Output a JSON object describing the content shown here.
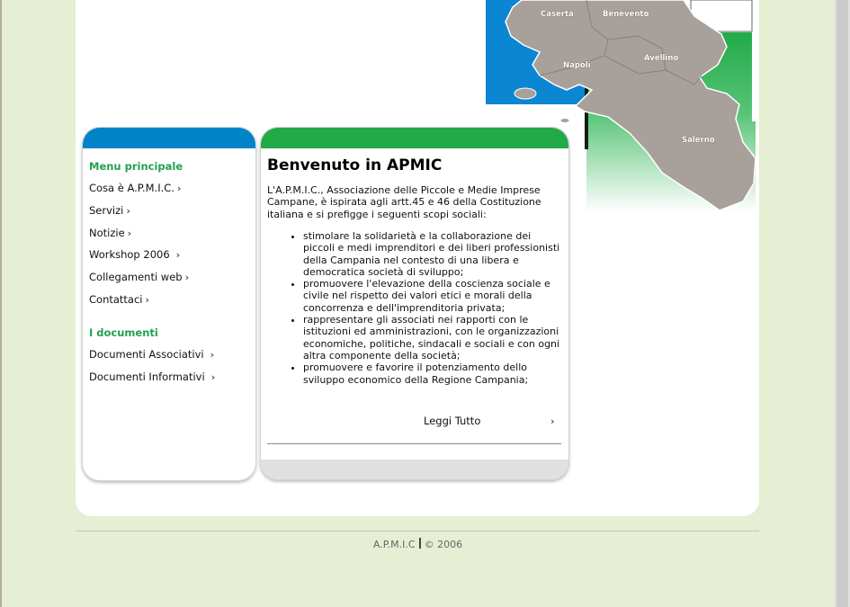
{
  "colors": {
    "page_background": "#e6eed3",
    "sidebar_cap": "#0083c8",
    "content_cap": "#22aa48",
    "section_title": "#21a14d",
    "map_region": "#a8a09a",
    "map_sea": "#0a86d2",
    "map_green": "#22aa48"
  },
  "map": {
    "labels": [
      "Caserta",
      "Benevento",
      "Napoli",
      "Avellino",
      "Salerno"
    ]
  },
  "sidebar": {
    "main_menu_title": "Menu principale",
    "main_menu": [
      {
        "label": "Cosa è A.P.M.I.C."
      },
      {
        "label": "Servizi"
      },
      {
        "label": "Notizie"
      },
      {
        "label": "Workshop 2006"
      },
      {
        "label": "Collegamenti web"
      },
      {
        "label": "Contattaci"
      }
    ],
    "documents_title": "I documenti",
    "documents": [
      {
        "label": "Documenti Associativi"
      },
      {
        "label": "Documenti Informativi"
      }
    ],
    "chevron": "›"
  },
  "content": {
    "title": "Benvenuto in APMIC",
    "intro": "L'A.P.M.I.C., Associazione delle Piccole e Medie Imprese Campane, è ispirata agli artt.45 e 46 della Costituzione italiana e si prefigge i seguenti scopi sociali:",
    "aims": [
      "stimolare la solidarietà e la collaborazione dei piccoli e medi imprenditori e dei liberi professionisti della Campania nel contesto di una libera e democratica società di sviluppo;",
      "promuovere l'elevazione della coscienza sociale e civile nel rispetto dei valori etici e morali della concorrenza e dell'imprenditoria privata;",
      "rappresentare gli associati nei rapporti con le istituzioni ed amministrazioni, con le organizzazioni economiche, politiche, sindacali e sociali e con ogni altra componente della società;",
      "promuovere e favorire il potenziamento dello sviluppo economico della Regione Campania;"
    ],
    "read_more": "Leggi Tutto",
    "read_more_chevron": "›"
  },
  "footer": {
    "org": "A.P.M.I.C",
    "copyright": "© 2006"
  }
}
